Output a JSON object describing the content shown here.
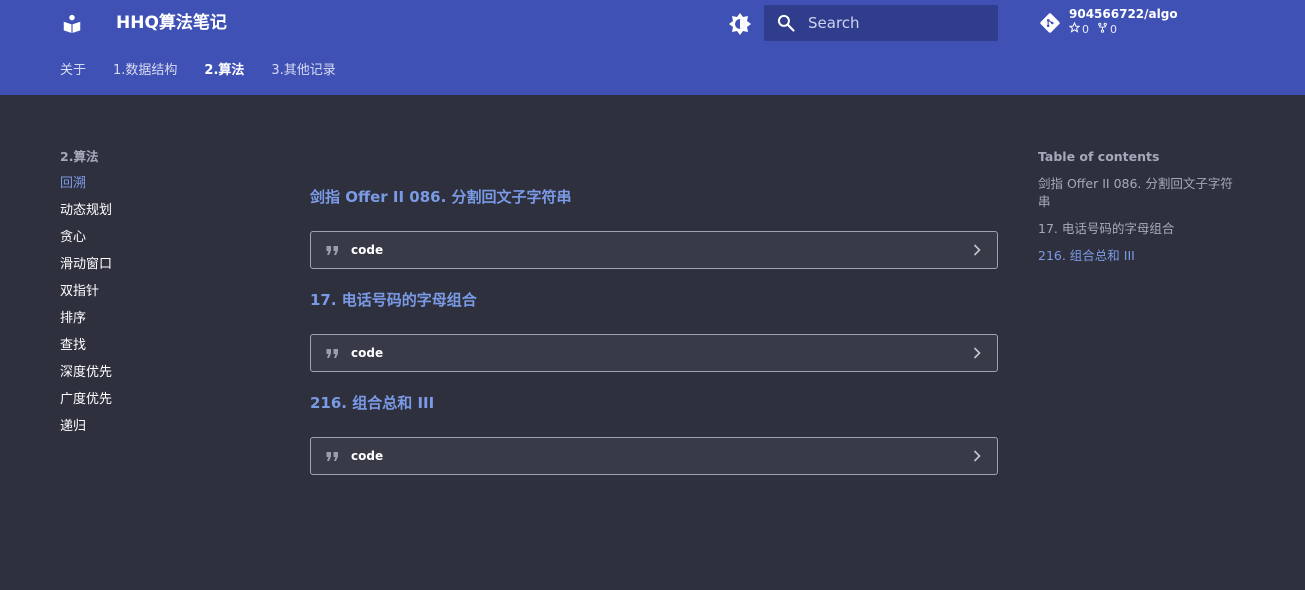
{
  "header": {
    "site_title": "HHQ算法笔记",
    "search_placeholder": "Search",
    "repo": {
      "name": "904566722/algo",
      "stars": "0",
      "forks": "0"
    },
    "tabs": [
      {
        "label": "关于",
        "active": false
      },
      {
        "label": "1.数据结构",
        "active": false
      },
      {
        "label": "2.算法",
        "active": true
      },
      {
        "label": "3.其他记录",
        "active": false
      }
    ]
  },
  "nav": {
    "title": "2.算法",
    "items": [
      {
        "label": "回溯",
        "active": true
      },
      {
        "label": "动态规划",
        "active": false
      },
      {
        "label": "贪心",
        "active": false
      },
      {
        "label": "滑动窗口",
        "active": false
      },
      {
        "label": "双指针",
        "active": false
      },
      {
        "label": "排序",
        "active": false
      },
      {
        "label": "查找",
        "active": false
      },
      {
        "label": "深度优先",
        "active": false
      },
      {
        "label": "广度优先",
        "active": false
      },
      {
        "label": "递归",
        "active": false
      }
    ]
  },
  "main": {
    "sections": [
      {
        "title": "剑指 Offer II 086. 分割回文子字符串",
        "details_label": "code"
      },
      {
        "title": "17. 电话号码的字母组合",
        "details_label": "code"
      },
      {
        "title": "216. 组合总和 III",
        "details_label": "code"
      }
    ]
  },
  "toc": {
    "title": "Table of contents",
    "items": [
      {
        "label": "剑指 Offer II 086. 分割回文子字符串",
        "active": false
      },
      {
        "label": "17. 电话号码的字母组合",
        "active": false
      },
      {
        "label": "216. 组合总和 III",
        "active": true
      }
    ]
  },
  "colors": {
    "header_bg": "#3f51b5",
    "search_bg": "#2f3d8c",
    "page_bg": "#2e303e",
    "accent": "#7b9ae5"
  },
  "icons": {
    "logo": "book-reader-icon",
    "palette": "brightness-icon",
    "search": "search-icon",
    "repo": "git-icon",
    "star": "star-icon",
    "fork": "fork-icon",
    "quote": "quote-icon",
    "chevron": "chevron-right-icon"
  }
}
